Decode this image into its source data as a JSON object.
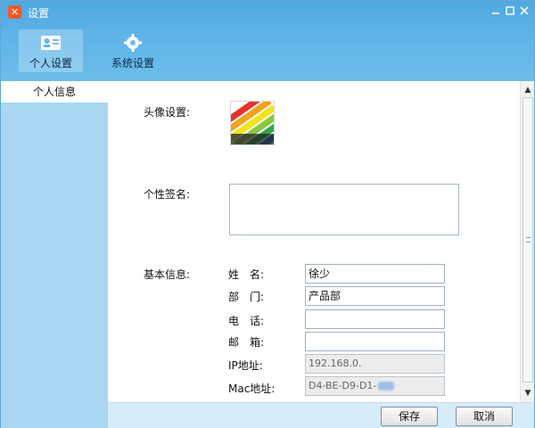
{
  "window": {
    "title": "设置"
  },
  "nav": {
    "tabs": [
      {
        "label": "个人设置",
        "icon": "contact-card-icon",
        "active": true
      },
      {
        "label": "系统设置",
        "icon": "gear-icon",
        "active": false
      }
    ]
  },
  "sidebar": {
    "items": [
      {
        "label": "个人信息",
        "selected": true
      }
    ]
  },
  "form": {
    "avatar_label": "头像设置:",
    "signature_label": "个性签名:",
    "signature_value": "",
    "basic_info_label": "基本信息:",
    "fields": [
      {
        "label": "姓　名:",
        "value": "徐少"
      },
      {
        "label": "部　门:",
        "value": "产品部"
      },
      {
        "label": "电　话:",
        "value": ""
      },
      {
        "label": "邮　箱:",
        "value": ""
      },
      {
        "label": "IP地址:",
        "value": "192.168.0."
      },
      {
        "label": "Mac地址:",
        "value": "D4-BE-D9-D1-"
      }
    ]
  },
  "footer": {
    "save_label": "保存",
    "cancel_label": "取消"
  },
  "colors": {
    "header": "#5fb4e8",
    "sidebar": "#a9d7f1",
    "footer": "#d7ecf9",
    "accent": "#f05a28"
  }
}
